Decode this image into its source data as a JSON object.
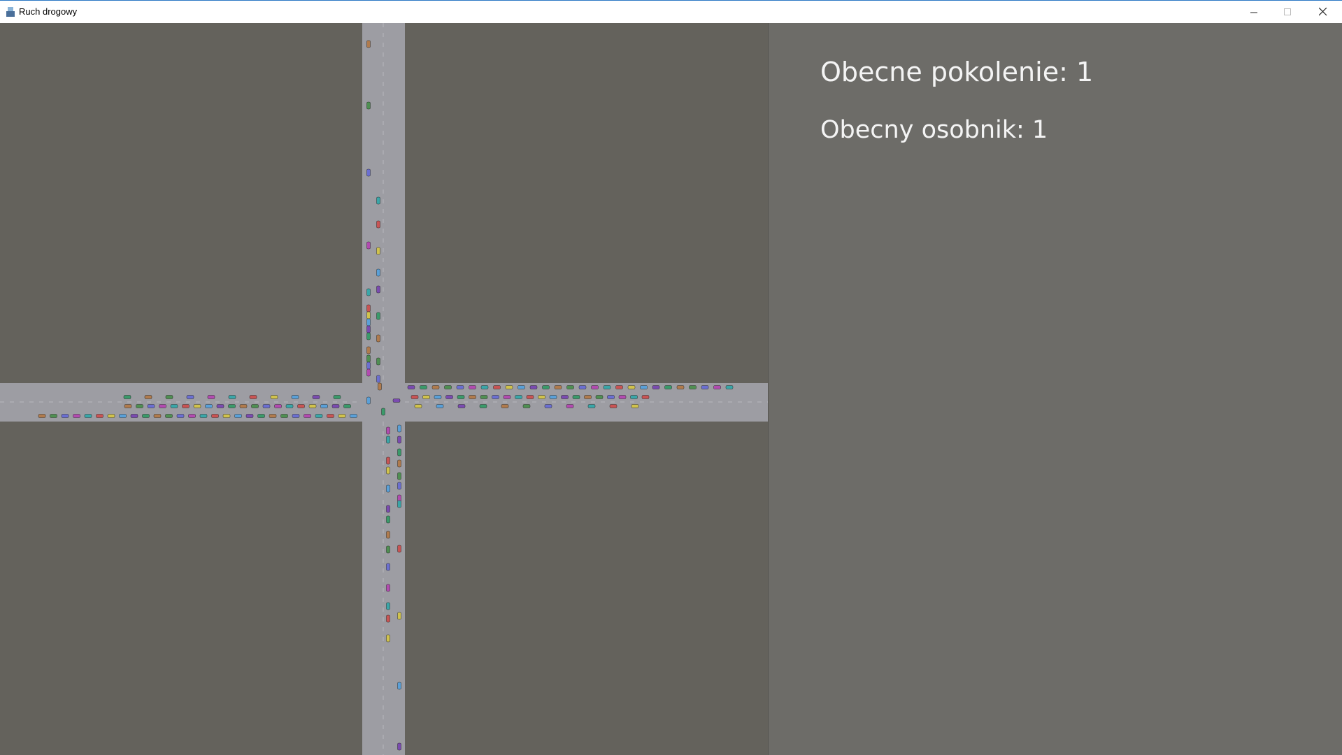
{
  "window": {
    "title": "Ruch drogowy",
    "controls": {
      "minimize_icon": "minimize-icon",
      "maximize_icon": "maximize-icon",
      "close_icon": "close-icon"
    }
  },
  "panel": {
    "generation_text": "Obecne pokolenie: 1",
    "individual_text": "Obecny osobnik: 1"
  },
  "colors": {
    "background": "#64625c",
    "panel": "#6d6c68",
    "road": "#9d9da3",
    "lane_marking": "#b8b8be",
    "car_palette": [
      "#b07b4d",
      "#4f8f52",
      "#6b6fd1",
      "#b24bb0",
      "#3aa6a8",
      "#c95454",
      "#d0c24d",
      "#5aa0d8",
      "#7a4bb0",
      "#3a9a6a"
    ]
  }
}
